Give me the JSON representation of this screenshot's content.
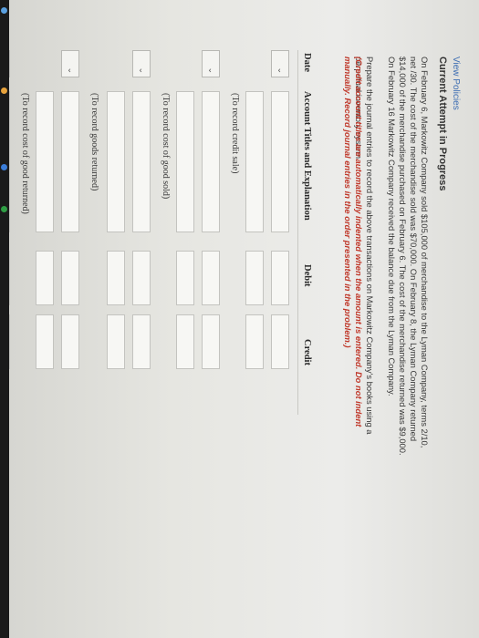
{
  "header": {
    "view_policies": "View Policies",
    "attempt_status": "Current Attempt in Progress"
  },
  "problem": {
    "scenario": "On February 6, Markowitz Company sold $105,000 of merchandise to the Lyman Company, terms 2/10, net /30. The cost of the merchandise sold was $70,000. On February 8, the Lyman Company returned $14,000 of the merchandise purchased on February 6. The cost of the merchandise returned was $9,000. On February 16 Markowitz Company received the balance due from the Lyman Company.",
    "instruction": "Prepare the journal entries to record the above transactions on Markowitz Company's books using a perpetual inventory system.",
    "note": "(Credit account titles are automatically indented when the amount is entered. Do not indent manually. Record journal entries in the order presented in the problem.)"
  },
  "table": {
    "col_date": "Date",
    "col_account": "Account Titles and Explanation",
    "col_debit": "Debit",
    "col_credit": "Credit"
  },
  "memos": {
    "credit_sale": "(To record credit sale)",
    "cost_of_goods_sold": "(To record cost of good sold)",
    "goods_returned": "(To record goods returned)",
    "cost_of_goods_returned": "(To record cost of good returned)"
  },
  "ui": {
    "dropdown_icon": "chevron-down-icon"
  }
}
